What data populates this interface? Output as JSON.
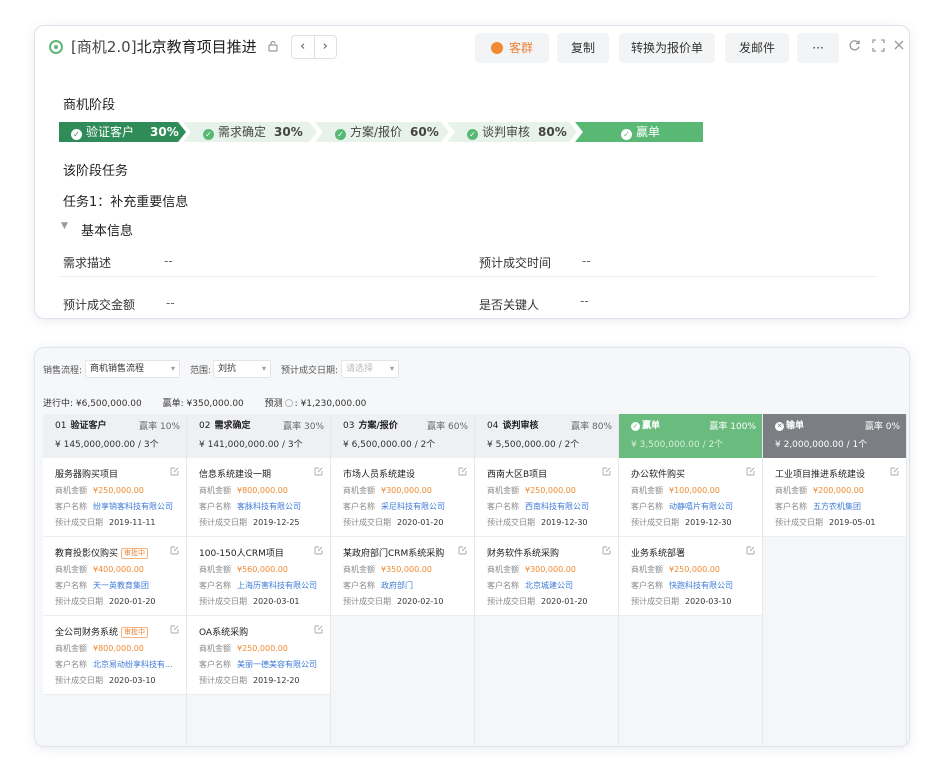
{
  "header": {
    "tag": "[商机2.0]",
    "title": "北京教育项目推进",
    "buttons": {
      "customer_group": "客群",
      "copy": "复制",
      "convert": "转换为报价单",
      "send_mail": "发邮件",
      "more": "···"
    },
    "nav_prev": "‹",
    "nav_next": "›"
  },
  "stage_section": {
    "label": "商机阶段",
    "stages": [
      {
        "name": "验证客户",
        "percent": "30%"
      },
      {
        "name": "需求确定",
        "percent": "30%"
      },
      {
        "name": "方案/报价",
        "percent": "60%"
      },
      {
        "name": "谈判审核",
        "percent": "80%"
      },
      {
        "name": "赢单",
        "percent": ""
      }
    ]
  },
  "tasks": {
    "section_label": "该阶段任务",
    "task1": "任务1：补充重要信息",
    "basic_info": "基本信息",
    "fields": [
      {
        "label": "需求描述",
        "value": "--"
      },
      {
        "label": "预计成交时间",
        "value": "--"
      },
      {
        "label": "预计成交金额",
        "value": "--"
      },
      {
        "label": "是否关键人",
        "value": "--"
      }
    ]
  },
  "filters": {
    "process_label": "销售流程:",
    "process_value": "商机销售流程",
    "scope_label": "范围:",
    "scope_value": "刘抗",
    "date_label": "预计成交日期:",
    "date_placeholder": "请选择"
  },
  "summary": {
    "in_progress": "进行中: ¥6,500,000.00",
    "won": "赢单: ¥350,000.00",
    "forecast_label": "预测",
    "forecast_value": ": ¥1,230,000.00"
  },
  "columns": [
    {
      "num": "01",
      "name": "验证客户",
      "rate": "赢率 10%",
      "amount": "¥ 145,000,000.00 / 3个",
      "deals": [
        {
          "title": "服务器购买项目",
          "badge": "",
          "amount": "¥250,000.00",
          "customer": "纷享销客科技有限公司",
          "date": "2019-11-11"
        },
        {
          "title": "教育投影仪购买",
          "badge": "审批中",
          "amount": "¥400,000.00",
          "customer": "天一英教育集团",
          "date": "2020-01-20"
        },
        {
          "title": "全公司财务系统",
          "badge": "审批中",
          "amount": "¥800,000.00",
          "customer": "北京易动纷享科技有...",
          "date": "2020-03-10"
        }
      ]
    },
    {
      "num": "02",
      "name": "需求确定",
      "rate": "赢率 30%",
      "amount": "¥ 141,000,000.00 / 3个",
      "deals": [
        {
          "title": "信息系统建设一期",
          "badge": "",
          "amount": "¥800,000.00",
          "customer": "客脉科技有限公司",
          "date": "2019-12-25"
        },
        {
          "title": "100-150人CRM项目",
          "badge": "",
          "amount": "¥560,000.00",
          "customer": "上海历害科技有限公司",
          "date": "2020-03-01"
        },
        {
          "title": "OA系统采购",
          "badge": "",
          "amount": "¥250,000.00",
          "customer": "美丽一德美容有限公司",
          "date": "2019-12-20"
        }
      ]
    },
    {
      "num": "03",
      "name": "方案/报价",
      "rate": "赢率 60%",
      "amount": "¥ 6,500,000.00 / 2个",
      "deals": [
        {
          "title": "市场人员系统建设",
          "badge": "",
          "amount": "¥300,000.00",
          "customer": "采尼科技有限公司",
          "date": "2020-01-20"
        },
        {
          "title": "某政府部门CRM系统采购",
          "badge": "",
          "amount": "¥350,000.00",
          "customer": "政府部门",
          "date": "2020-02-10"
        }
      ]
    },
    {
      "num": "04",
      "name": "谈判审核",
      "rate": "赢率 80%",
      "amount": "¥ 5,500,000.00 / 2个",
      "deals": [
        {
          "title": "西南大区B项目",
          "badge": "",
          "amount": "¥250,000.00",
          "customer": "西南科技有限公司",
          "date": "2019-12-30"
        },
        {
          "title": "财务软件系统采购",
          "badge": "",
          "amount": "¥300,000.00",
          "customer": "北京城建公司",
          "date": "2020-01-20"
        }
      ]
    },
    {
      "num": "",
      "name": "赢单",
      "rate": "赢率 100%",
      "amount": "¥ 3,500,000.00 / 2个",
      "deals": [
        {
          "title": "办公软件购买",
          "badge": "",
          "amount": "¥100,000.00",
          "customer": "动静嘻片有限公司",
          "date": "2019-12-30"
        },
        {
          "title": "业务系统部署",
          "badge": "",
          "amount": "¥250,000.00",
          "customer": "快跑科技有限公司",
          "date": "2020-03-10"
        }
      ]
    },
    {
      "num": "",
      "name": "输单",
      "rate": "赢率 0%",
      "amount": "¥ 2,000,000.00 / 1个",
      "deals": [
        {
          "title": "工业项目推进系统建设",
          "badge": "",
          "amount": "¥200,000.00",
          "customer": "五方农机集团",
          "date": "2019-05-01"
        }
      ]
    }
  ],
  "deal_labels": {
    "amount": "商机金额",
    "customer": "客户名称",
    "date": "预计成交日期"
  },
  "colors": {
    "accent_green": "#2f8b57",
    "won_green": "#69bb7e",
    "lost_grey": "#7b7f84",
    "orange": "#f0892f",
    "link_blue": "#3d7bd9"
  }
}
